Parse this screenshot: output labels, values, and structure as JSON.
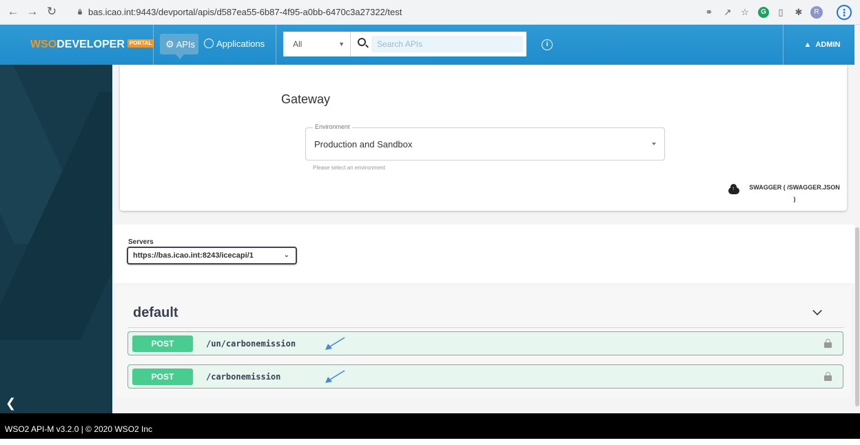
{
  "browser": {
    "url": "bas.icao.int:9443/devportal/apis/d587ea55-6b87-4f95-a0bb-6470c3a27322/test",
    "back_icon": "arrow-left-icon",
    "forward_icon": "arrow-right-icon",
    "reload_icon": "reload-icon",
    "profile_initial": "R"
  },
  "header": {
    "brand_prefix": "WSO",
    "brand_suffix": "DEVELOPER",
    "brand_tag": "PORTAL",
    "nav_apis": "APIs",
    "nav_applications": "Applications",
    "search_scope": "All",
    "search_placeholder": "Search APIs",
    "user_label": "ADMIN",
    "header_color": "#1f8ccc"
  },
  "gateway": {
    "title": "Gateway",
    "environment_label": "Environment",
    "environment_value": "Production and Sandbox",
    "environment_help": "Please select an environment",
    "swagger_line1": "SWAGGER ( /SWAGGER.JSON",
    "swagger_line2": ")"
  },
  "servers": {
    "label": "Servers",
    "selected": "https://bas.icao.int:8243/icecapi/1"
  },
  "operations": {
    "tag": "default",
    "items": [
      {
        "method": "POST",
        "path": "/un/carbonemission"
      },
      {
        "method": "POST",
        "path": "/carbonemission"
      }
    ],
    "post_color": "#49cc90"
  },
  "footer": {
    "text": "WSO2 API-M v3.2.0 | © 2020 WSO2 Inc"
  }
}
